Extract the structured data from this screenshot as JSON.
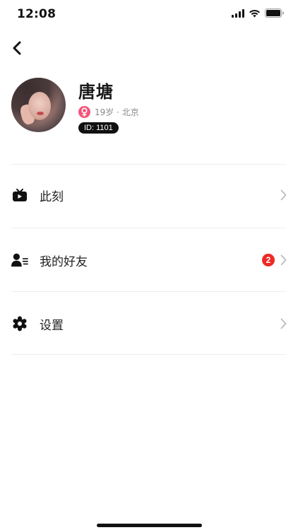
{
  "status_bar": {
    "time": "12:08"
  },
  "profile": {
    "name": "唐塘",
    "age_location": "19岁 · 北京",
    "id_label": "ID: 1101"
  },
  "menu": {
    "items": [
      {
        "label": "此刻",
        "icon": "tv-icon"
      },
      {
        "label": "我的好友",
        "icon": "friends-icon",
        "badge": "2"
      },
      {
        "label": "设置",
        "icon": "gear-icon"
      }
    ]
  },
  "colors": {
    "gender_female": "#f2557a",
    "badge_red": "#ee2a24",
    "divider": "#eeeeee"
  }
}
